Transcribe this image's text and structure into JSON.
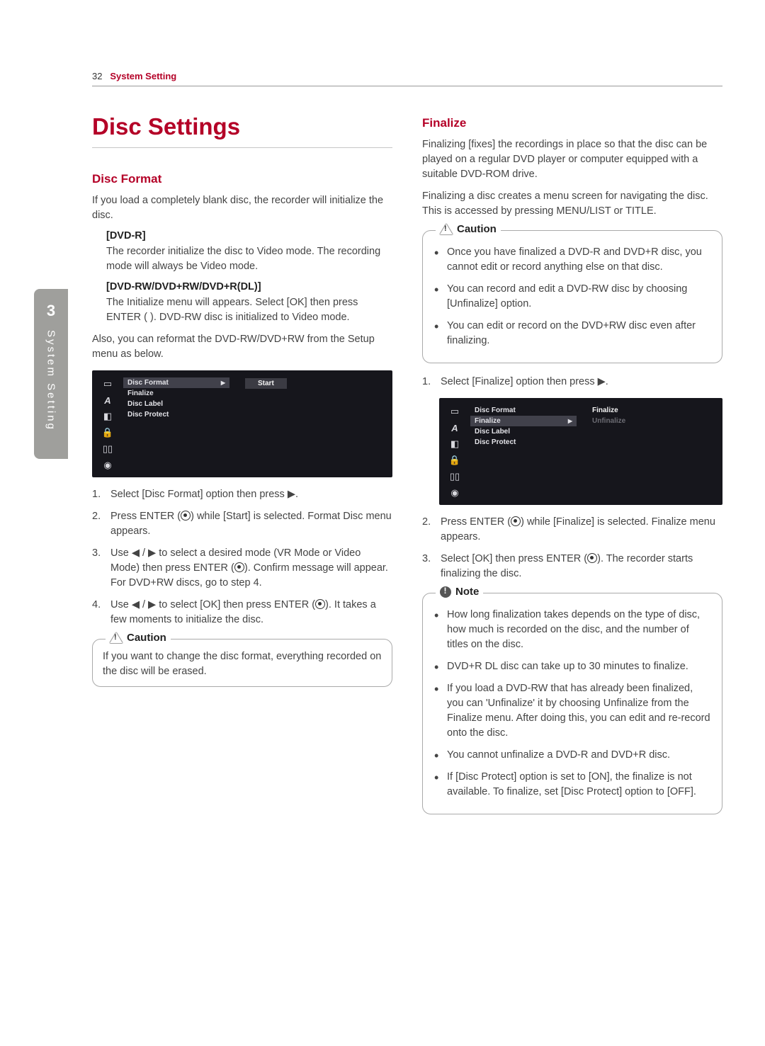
{
  "page": {
    "number": "32",
    "section": "System Setting"
  },
  "sidebar": {
    "chapter": "3",
    "label": "System Setting"
  },
  "left": {
    "title": "Disc Settings",
    "h_format": "Disc Format",
    "intro": "If you load a completely blank disc, the recorder will initialize the disc.",
    "dvd_r_head": "[DVD-R]",
    "dvd_r_body": "The recorder initialize the disc to Video mode. The recording mode will always be Video mode.",
    "dvd_rw_head": "[DVD-RW/DVD+RW/DVD+R(DL)]",
    "dvd_rw_body": "The Initialize menu will appears. Select [OK] then press ENTER (    ). DVD-RW disc is initialized to Video mode.",
    "also": "Also, you can reformat the DVD-RW/DVD+RW from the Setup menu as below.",
    "steps": {
      "s1": "Select [Disc Format] option then press ▶.",
      "s2a": "Press ENTER (",
      "s2b": ") while [Start] is selected. Format Disc menu appears.",
      "s3a": "Use ◀ / ▶ to select a desired mode (VR Mode or Video Mode) then press ENTER (",
      "s3b": "). Confirm message will appear. For DVD+RW discs, go to step 4.",
      "s4a": "Use ◀ / ▶ to select [OK] then press ENTER (",
      "s4b": "). It takes a few moments to initialize the disc."
    },
    "caution_label": "Caution",
    "caution_body": "If you want to change the disc format, everything recorded on the disc will be erased."
  },
  "menu1": {
    "items": [
      "Disc Format",
      "Finalize",
      "Disc Label",
      "Disc Protect"
    ],
    "selected": "Disc Format",
    "right_option": "Start"
  },
  "right": {
    "h_finalize": "Finalize",
    "p1": "Finalizing [fixes] the recordings in place so that the disc can be played on a regular DVD player or computer equipped with a suitable DVD-ROM drive.",
    "p2": "Finalizing a disc creates a menu screen for navigating the disc. This is accessed by pressing MENU/LIST or TITLE.",
    "caution_label": "Caution",
    "caution_items": [
      "Once you have finalized a DVD-R and DVD+R disc, you cannot edit or record anything else on that disc.",
      "You can record and edit a DVD-RW disc by choosing [Unfinalize] option.",
      "You can edit or record on the DVD+RW disc even after finalizing."
    ],
    "step1": "Select [Finalize] option then press ▶.",
    "step2a": "Press ENTER (",
    "step2b": ") while [Finalize] is selected. Finalize menu appears.",
    "step3a": "Select [OK] then press ENTER (",
    "step3b": "). The recorder starts finalizing the disc.",
    "note_label": "Note",
    "note_items": [
      "How long finalization takes depends on the type of disc, how much is recorded on the disc, and the number of titles on the disc.",
      "DVD+R DL disc can take up to 30 minutes to finalize.",
      "If you load a DVD-RW that has already been finalized, you can 'Unfinalize' it by choosing Unfinalize from the Finalize menu. After doing this, you can edit and re-record onto the disc.",
      "You cannot unfinalize a DVD-R and DVD+R disc.",
      "If [Disc Protect] option is set to [ON], the finalize is not available. To finalize, set [Disc Protect] option to [OFF]."
    ]
  },
  "menu2": {
    "items": [
      "Disc Format",
      "Finalize",
      "Disc Label",
      "Disc Protect"
    ],
    "selected": "Finalize",
    "right_options": [
      "Finalize",
      "Unfinalize"
    ]
  }
}
